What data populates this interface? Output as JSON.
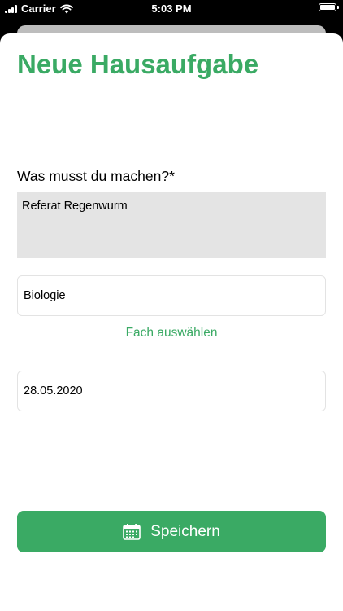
{
  "status_bar": {
    "carrier": "Carrier",
    "time": "5:03 PM",
    "battery_level": 1.0
  },
  "page": {
    "title": "Neue Hausaufgabe"
  },
  "task": {
    "label": "Was musst du machen?*",
    "value": "Referat Regenwurm"
  },
  "subject": {
    "value": "Biologie",
    "choose_label": "Fach auswählen"
  },
  "date": {
    "value": "28.05.2020"
  },
  "save_button": {
    "label": "Speichern",
    "icon": "calendar-icon"
  },
  "colors": {
    "accent": "#3aaa64",
    "text_area_background": "#e4e4e4"
  }
}
